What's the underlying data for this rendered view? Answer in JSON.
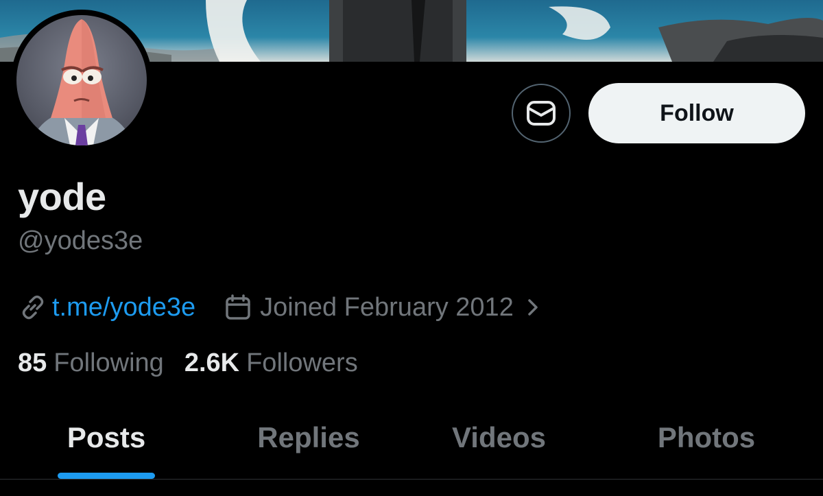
{
  "profile": {
    "display_name": "yode",
    "handle": "@yodes3e",
    "link": "t.me/yode3e",
    "joined": "Joined February 2012"
  },
  "actions": {
    "follow_label": "Follow"
  },
  "stats": {
    "following_count": "85",
    "following_label": "Following",
    "followers_count": "2.6K",
    "followers_label": "Followers"
  },
  "tabs": [
    {
      "label": "Posts",
      "active": true
    },
    {
      "label": "Replies",
      "active": false
    },
    {
      "label": "Videos",
      "active": false
    },
    {
      "label": "Photos",
      "active": false
    }
  ],
  "icons": {
    "message": "envelope-icon",
    "link": "link-icon",
    "joined": "calendar-icon",
    "chevron": "chevron-right-icon"
  },
  "colors": {
    "accent": "#1d9bf0",
    "muted": "#71767b",
    "primary_text": "#e7e9ea",
    "follow_bg": "#eff3f4"
  }
}
